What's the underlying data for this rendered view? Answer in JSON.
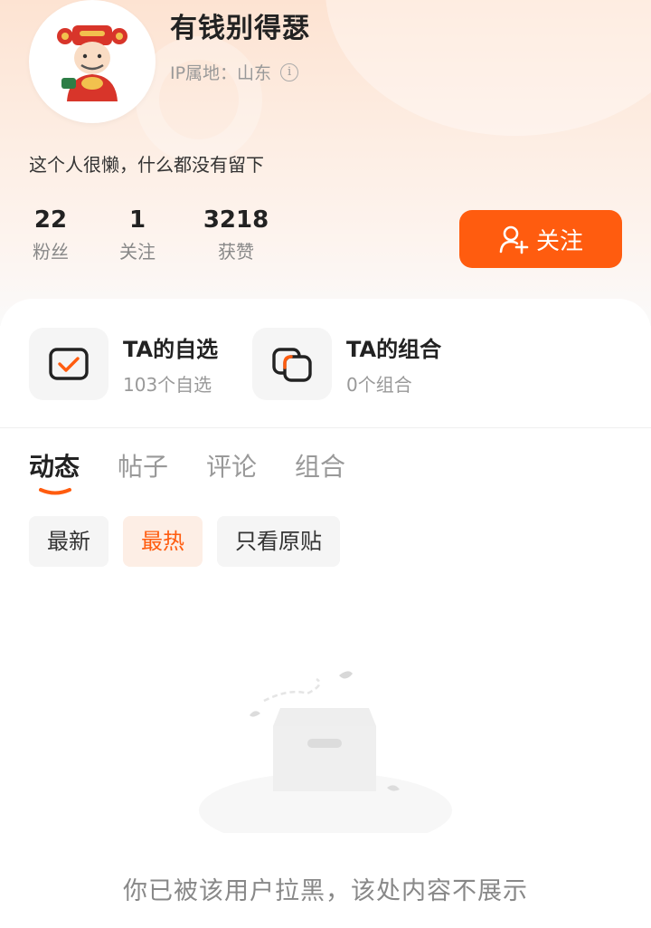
{
  "profile": {
    "username": "有钱别得瑟",
    "ip_location": "IP属地：山东",
    "bio": "这个人很懒，什么都没有留下",
    "avatar": "caishen-avatar"
  },
  "stats": [
    {
      "value": "22",
      "label": "粉丝"
    },
    {
      "value": "1",
      "label": "关注"
    },
    {
      "value": "3218",
      "label": "获赞"
    }
  ],
  "follow_button": {
    "label": "关注",
    "icon": "add-user-icon",
    "color": "#ff5c0f"
  },
  "favorites": [
    {
      "title": "TA的自选",
      "subtitle": "103个自选",
      "icon": "checkbox-icon"
    },
    {
      "title": "TA的组合",
      "subtitle": "0个组合",
      "icon": "stacked-squares-icon"
    }
  ],
  "tabs": [
    {
      "label": "动态",
      "active": true
    },
    {
      "label": "帖子",
      "active": false
    },
    {
      "label": "评论",
      "active": false
    },
    {
      "label": "组合",
      "active": false
    }
  ],
  "filters": [
    {
      "label": "最新",
      "active": false
    },
    {
      "label": "最热",
      "active": true
    },
    {
      "label": "只看原贴",
      "active": false
    }
  ],
  "empty_state": {
    "message": "你已被该用户拉黑，该处内容不展示",
    "icon": "empty-box-icon"
  },
  "colors": {
    "accent": "#ff5c0f",
    "accent_soft": "#fdeee5"
  }
}
